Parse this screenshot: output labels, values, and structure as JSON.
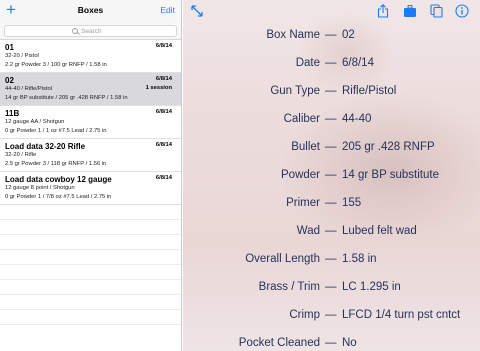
{
  "master": {
    "add_label": "+",
    "title": "Boxes",
    "edit_label": "Edit",
    "search_placeholder": "Search",
    "rows": [
      {
        "name": "01",
        "date": "6/8/14",
        "line1": "32-20 / Pistol",
        "line2": "2.2 gr Powder 3 / 100 gr RNFP / 1.58 in",
        "session": ""
      },
      {
        "name": "02",
        "date": "6/8/14",
        "line1": "44-40 / Rifle/Pistol",
        "line2": "14 gr BP substitute / 205 gr .428 RNFP / 1.58 in",
        "session": "1 session"
      },
      {
        "name": "11B",
        "date": "6/8/14",
        "line1": "12 gauge AA / Shotgun",
        "line2": "0 gr Powder 1 / 1 oz  #7.5 Lead / 2.75 in",
        "session": ""
      },
      {
        "name": "Load data 32-20 Rifle",
        "date": "6/8/14",
        "line1": "32-20 / Rifle",
        "line2": "2.5 gr Powder 3 / 118 gr RNFP / 1.56 in",
        "session": ""
      },
      {
        "name": "Load data cowboy 12 gauge",
        "date": "6/8/14",
        "line1": "12 gauge 8 point / Shotgun",
        "line2": "0 gr Powder 1 / 7/8 oz  #7.5 Lead / 2.75 in",
        "session": ""
      }
    ],
    "selected_index": 1
  },
  "detail": {
    "dash": "—",
    "fields": [
      {
        "label": "Box Name",
        "value": "02"
      },
      {
        "label": "Date",
        "value": "6/8/14"
      },
      {
        "label": "Gun Type",
        "value": "Rifle/Pistol"
      },
      {
        "label": "Caliber",
        "value": "44-40"
      },
      {
        "label": "Bullet",
        "value": "205 gr .428 RNFP"
      },
      {
        "label": "Powder",
        "value": "14 gr BP substitute"
      },
      {
        "label": "Primer",
        "value": "155"
      },
      {
        "label": "Wad",
        "value": "Lubed felt wad"
      },
      {
        "label": "Overall Length",
        "value": "1.58 in"
      },
      {
        "label": "Brass / Trim",
        "value": "LC 1.295 in"
      },
      {
        "label": "Crimp",
        "value": "LFCD 1/4 turn pst cntct"
      },
      {
        "label": "Pocket Cleaned",
        "value": "No"
      }
    ]
  },
  "colors": {
    "accent": "#1a7cf5",
    "detail_text": "#27325a",
    "selected_row": "#d9d9dd"
  },
  "icons": [
    "add-icon",
    "search-icon",
    "expand-icon",
    "share-icon",
    "briefcase-icon",
    "copy-icon",
    "info-icon"
  ]
}
